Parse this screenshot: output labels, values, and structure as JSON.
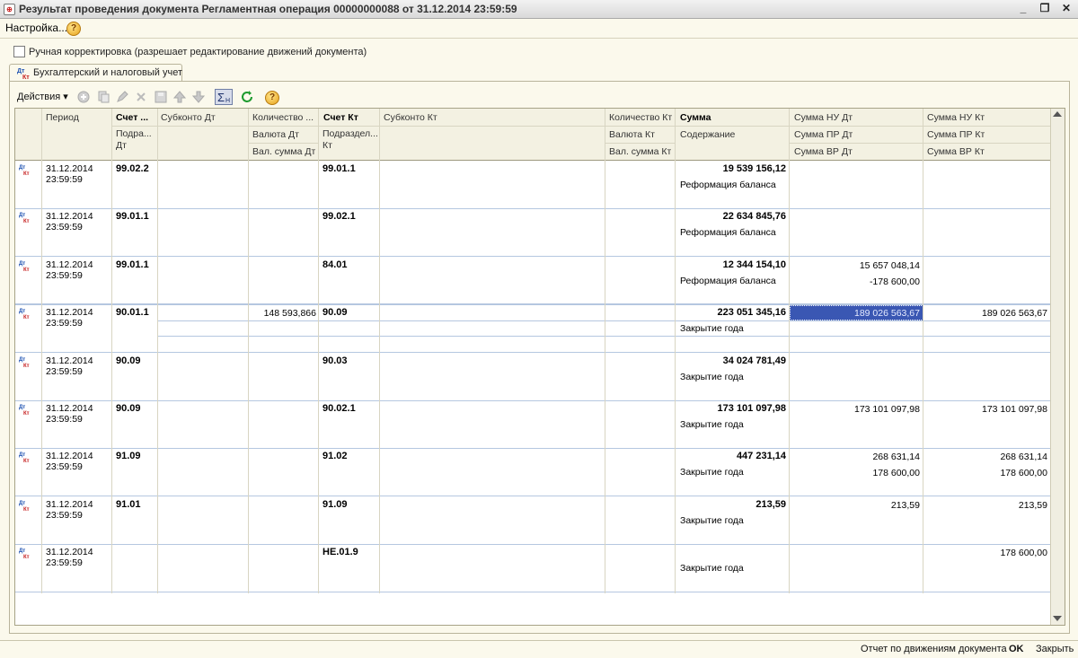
{
  "window": {
    "title": "Результат проведения документа Регламентная операция 00000000088 от 31.12.2014 23:59:59"
  },
  "menubar": {
    "settings_label": "Настройка...",
    "help": "?"
  },
  "manual_correction": {
    "label": "Ручная корректировка (разрешает редактирование движений документа)",
    "checked": false
  },
  "tab": {
    "label": "Бухгалтерский и налоговый учет"
  },
  "toolbar": {
    "actions_label": "Действия ▾",
    "help": "?"
  },
  "columns": {
    "period": "Период",
    "account_dt": "Счет ...",
    "subdivision_dt": "Подра... Дт",
    "subconto_dt": "Субконто Дт",
    "qty_dt": "Количество ...",
    "currency_dt": "Валюта Дт",
    "cur_amount_dt": "Вал. сумма Дт",
    "account_kt": "Счет Кт",
    "subdivision_kt": "Подраздел... Кт",
    "subconto_kt": "Субконто Кт",
    "qty_kt": "Количество Кт",
    "currency_kt": "Валюта Кт",
    "cur_amount_kt": "Вал. сумма Кт",
    "sum": "Сумма",
    "content": "Содержание",
    "sum_nu_dt": "Сумма НУ Дт",
    "sum_pr_dt": "Сумма ПР Дт",
    "sum_vr_dt": "Сумма ВР Дт",
    "sum_nu_kt": "Сумма НУ Кт",
    "sum_pr_kt": "Сумма ПР Кт",
    "sum_vr_kt": "Сумма ВР Кт"
  },
  "rows": [
    {
      "date": "31.12.2014",
      "time": "23:59:59",
      "acc_dt": "99.02.2",
      "qty_dt": "",
      "acc_kt": "99.01.1",
      "sum": "19 539 156,12",
      "content": "Реформация баланса",
      "nu_dt": "",
      "pr_dt": "",
      "nu_kt": "",
      "pr_kt": ""
    },
    {
      "date": "31.12.2014",
      "time": "23:59:59",
      "acc_dt": "99.01.1",
      "qty_dt": "",
      "acc_kt": "99.02.1",
      "sum": "22 634 845,76",
      "content": "Реформация баланса",
      "nu_dt": "",
      "pr_dt": "",
      "nu_kt": "",
      "pr_kt": ""
    },
    {
      "date": "31.12.2014",
      "time": "23:59:59",
      "acc_dt": "99.01.1",
      "qty_dt": "",
      "acc_kt": "84.01",
      "sum": "12 344 154,10",
      "content": "Реформация баланса",
      "nu_dt": "15 657 048,14",
      "pr_dt": "-178 600,00",
      "nu_kt": "",
      "pr_kt": ""
    },
    {
      "date": "31.12.2014",
      "time": "23:59:59",
      "acc_dt": "90.01.1",
      "qty_dt": "148 593,866",
      "acc_kt": "90.09",
      "sum": "223 051 345,16",
      "content": "Закрытие года",
      "nu_dt": "189 026 563,67",
      "pr_dt": "",
      "nu_kt": "189 026 563,67",
      "pr_kt": ""
    },
    {
      "date": "31.12.2014",
      "time": "23:59:59",
      "acc_dt": "90.09",
      "qty_dt": "",
      "acc_kt": "90.03",
      "sum": "34 024 781,49",
      "content": "Закрытие года",
      "nu_dt": "",
      "pr_dt": "",
      "nu_kt": "",
      "pr_kt": ""
    },
    {
      "date": "31.12.2014",
      "time": "23:59:59",
      "acc_dt": "90.09",
      "qty_dt": "",
      "acc_kt": "90.02.1",
      "sum": "173 101 097,98",
      "content": "Закрытие года",
      "nu_dt": "173 101 097,98",
      "pr_dt": "",
      "nu_kt": "173 101 097,98",
      "pr_kt": ""
    },
    {
      "date": "31.12.2014",
      "time": "23:59:59",
      "acc_dt": "91.09",
      "qty_dt": "",
      "acc_kt": "91.02",
      "sum": "447 231,14",
      "content": "Закрытие года",
      "nu_dt": "268 631,14",
      "pr_dt": "178 600,00",
      "nu_kt": "268 631,14",
      "pr_kt": "178 600,00"
    },
    {
      "date": "31.12.2014",
      "time": "23:59:59",
      "acc_dt": "91.01",
      "qty_dt": "",
      "acc_kt": "91.09",
      "sum": "213,59",
      "content": "Закрытие года",
      "nu_dt": "213,59",
      "pr_dt": "",
      "nu_kt": "213,59",
      "pr_kt": ""
    },
    {
      "date": "31.12.2014",
      "time": "23:59:59",
      "acc_dt": "",
      "qty_dt": "",
      "acc_kt": "НЕ.01.9",
      "sum": "",
      "content": "Закрытие года",
      "nu_dt": "",
      "pr_dt": "",
      "nu_kt": "178 600,00",
      "pr_kt": ""
    }
  ],
  "selection": {
    "row_index": 3,
    "column": "nu_dt"
  },
  "statusbar": {
    "report_label": "Отчет по движениям документа",
    "ok_label": "OK",
    "close_label": "Закрыть"
  },
  "colors": {
    "selection": "#3a57b3",
    "row_border": "#b5c7e0",
    "header_bg": "#f3f1e2",
    "window_bg": "#fbf9ec"
  }
}
